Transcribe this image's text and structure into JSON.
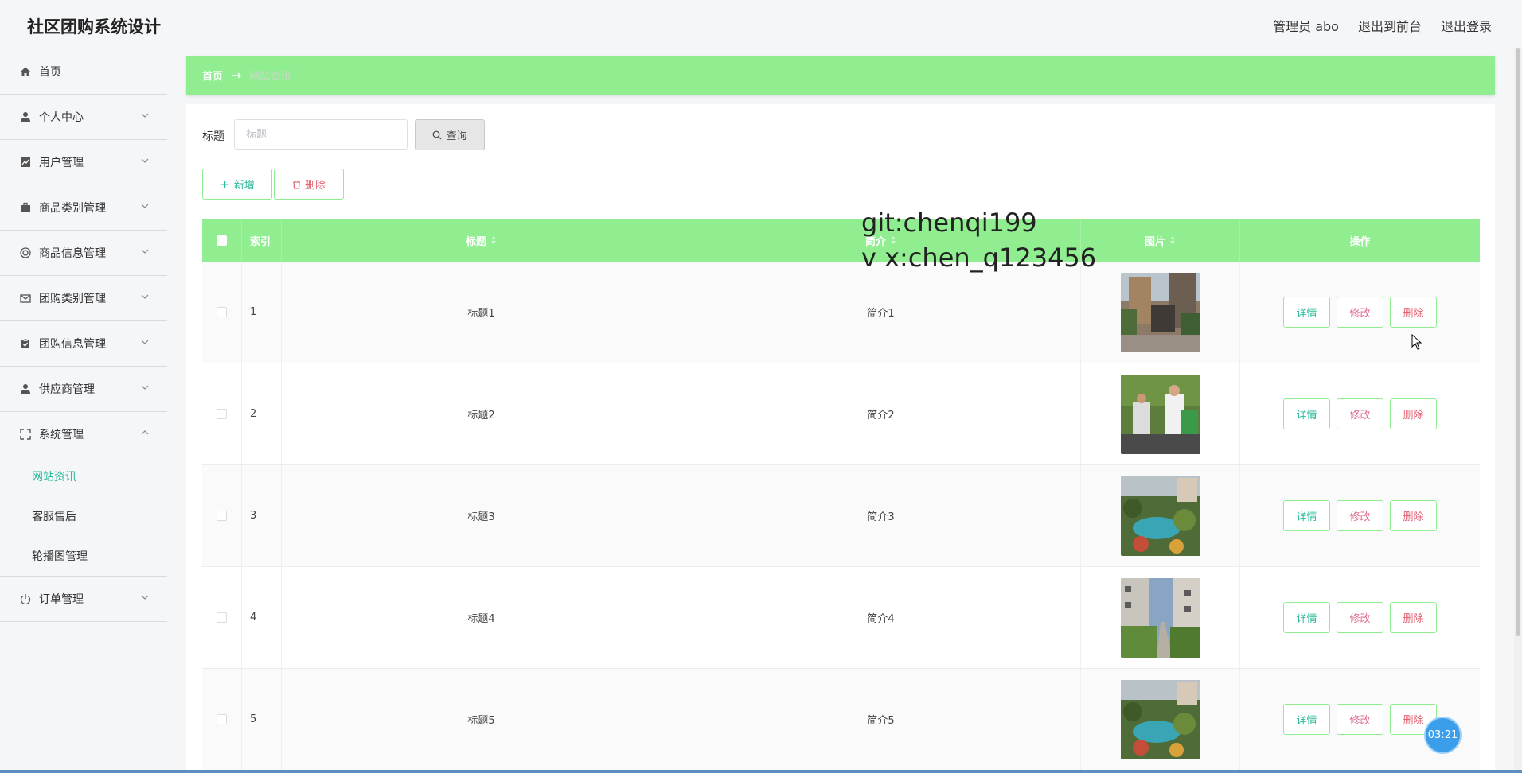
{
  "app": {
    "title": "社区团购系统设计"
  },
  "header": {
    "user_label": "管理员 abo",
    "to_front": "退出到前台",
    "logout": "退出登录"
  },
  "sidebar": {
    "items": [
      {
        "label": "首页",
        "icon": "home-icon"
      },
      {
        "label": "个人中心",
        "icon": "user-icon"
      },
      {
        "label": "用户管理",
        "icon": "chart-icon"
      },
      {
        "label": "商品类别管理",
        "icon": "briefcase-icon"
      },
      {
        "label": "商品信息管理",
        "icon": "target-icon"
      },
      {
        "label": "团购类别管理",
        "icon": "mail-icon"
      },
      {
        "label": "团购信息管理",
        "icon": "clipboard-icon"
      },
      {
        "label": "供应商管理",
        "icon": "user-icon"
      },
      {
        "label": "系统管理",
        "icon": "fullscreen-icon"
      },
      {
        "label": "订单管理",
        "icon": "power-icon"
      }
    ],
    "system_sub": [
      {
        "label": "网站资讯",
        "active": true
      },
      {
        "label": "客服售后",
        "active": false
      },
      {
        "label": "轮播图管理",
        "active": false
      }
    ]
  },
  "breadcrumb": {
    "home": "首页",
    "separator": "→",
    "current": "网站资讯"
  },
  "search": {
    "label": "标题",
    "placeholder": "标题",
    "value": "",
    "button": "查询"
  },
  "actions": {
    "add": "新增",
    "delete": "删除"
  },
  "table": {
    "headers": {
      "index": "索引",
      "title": "标题",
      "intro": "简介",
      "image": "图片",
      "operation": "操作"
    },
    "rows": [
      {
        "index": "1",
        "title": "标题1",
        "intro": "简介1",
        "image": "building-gate-photo"
      },
      {
        "index": "2",
        "title": "标题2",
        "intro": "简介2",
        "image": "people-outdoor-photo"
      },
      {
        "index": "3",
        "title": "标题3",
        "intro": "简介3",
        "image": "garden-pond-photo"
      },
      {
        "index": "4",
        "title": "标题4",
        "intro": "简介4",
        "image": "residential-path-photo"
      },
      {
        "index": "5",
        "title": "标题5",
        "intro": "简介5",
        "image": "garden-pond-photo"
      }
    ],
    "row_buttons": {
      "detail": "详情",
      "edit": "修改",
      "delete": "删除"
    }
  },
  "overlay": {
    "watermark_line1": "git:chenqi199",
    "watermark_line2": "v x:chen_q123456",
    "timer": "03:21"
  },
  "colors": {
    "accent": "#90ee90",
    "teal": "#29b99a",
    "danger": "#e05b6d",
    "background": "#f5f6f8"
  }
}
